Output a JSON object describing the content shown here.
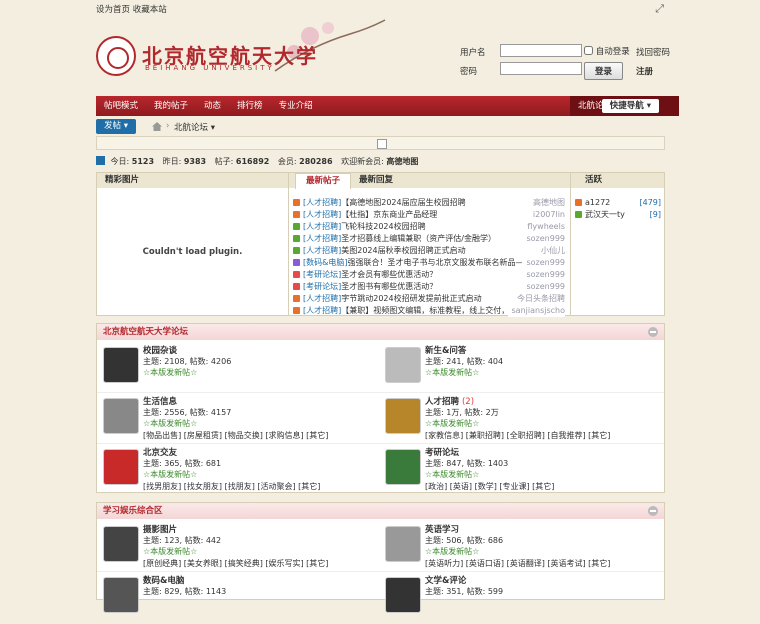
{
  "topbar": {
    "set_home": "设为首页",
    "bookmark": "收藏本站"
  },
  "logo": {
    "cn": "北京航空航天大学",
    "en": "BEIHANG UNIVERSITY"
  },
  "login": {
    "username_label": "用户名",
    "password_label": "密码",
    "auto_login": "自动登录",
    "forgot": "找回密码",
    "login_btn": "登录",
    "register": "注册"
  },
  "nav": {
    "items": [
      "北航论坛",
      "帖吧模式",
      "我的帖子",
      "动态",
      "排行榜",
      "专业介绍"
    ],
    "active_index": 0,
    "quick": "快捷导航"
  },
  "crumb": {
    "post": "发帖",
    "label": "北航论坛"
  },
  "stats": {
    "today_label": "今日:",
    "today": "5123",
    "yesterday_label": "昨日:",
    "yesterday": "9383",
    "posts_label": "帖子:",
    "posts": "616892",
    "members_label": "会员:",
    "members": "280286",
    "welcome_label": "欢迎新会员:",
    "newest": "高德地图"
  },
  "panel": {
    "pic_tab": "精彩图片",
    "plugin_msg": "Couldn't load plugin.",
    "tab_new": "最新帖子",
    "tab_reply": "最新回复",
    "active_tab": "活跃",
    "threads": [
      {
        "cat": "[人才招聘]",
        "title": "【高德地图2024届应届生校园招聘",
        "author": "高德地图",
        "color": "#e8702a"
      },
      {
        "cat": "[人才招聘]",
        "title": "【杜指】京东商业产品经理",
        "author": "i2007lin",
        "color": "#e8702a"
      },
      {
        "cat": "[人才招聘]",
        "title": "飞轮科技2024校园招聘",
        "author": "flywheels",
        "color": "#5aa832"
      },
      {
        "cat": "[人才招聘]",
        "title": "圣才招募线上编辑兼职（资产评估/金融学）",
        "author": "sozen999",
        "color": "#5aa832"
      },
      {
        "cat": "[人才招聘]",
        "title": "美图2024届秋季校园招聘正式启动",
        "author": "小仙儿",
        "color": "#5aa832"
      },
      {
        "cat": "[数码&电脑]",
        "title": "强强联合！圣才电子书与北京文服发布联名新品——圣才...",
        "author": "sozen999",
        "color": "#8a5ad8"
      },
      {
        "cat": "[考研论坛]",
        "title": "圣才会员有哪些优惠活动？",
        "author": "sozen999",
        "color": "#e84a4a"
      },
      {
        "cat": "[考研论坛]",
        "title": "圣才图书有哪些优惠活动？",
        "author": "sozen999",
        "color": "#e84a4a"
      },
      {
        "cat": "[人才招聘]",
        "title": "字节跳动2024校招研发提前批正式启动",
        "author": "今日头条招聘",
        "color": "#e8702a"
      },
      {
        "cat": "[人才招聘]",
        "title": "【兼职】视频图文编辑，标准教程，线上交付，熟练加薪",
        "author": "sanjiansjscho",
        "color": "#e8702a"
      }
    ],
    "active_users": [
      {
        "name": "a1272",
        "count": "[479]",
        "color": "#e8702a"
      },
      {
        "name": "武汉天一ty",
        "count": "[9]",
        "color": "#5aa832"
      }
    ]
  },
  "sections": [
    {
      "title": "北京航空航天大学论坛",
      "forums": [
        {
          "name": "校园杂谈",
          "stats": "主题: 2108, 帖数: 4206",
          "promo": "☆本版发新帖☆",
          "subs": "",
          "icon": "#333",
          "new": ""
        },
        {
          "name": "新生&问答",
          "stats": "主题: 241, 帖数: 404",
          "promo": "☆本版发新帖☆",
          "subs": "",
          "icon": "#bbb",
          "new": ""
        },
        {
          "name": "生活信息",
          "stats": "主题: 2556, 帖数: 4157",
          "promo": "☆本版发新帖☆",
          "subs": "[物品出售] [房屋租赁] [物品交换] [求购信息] [其它]",
          "icon": "#888",
          "new": ""
        },
        {
          "name": "人才招聘",
          "stats": "主题: 1万, 帖数: 2万",
          "promo": "☆本版发新帖☆",
          "subs": "[家教信息] [兼职招聘] [全职招聘] [自我推荐] [其它]",
          "icon": "#b8862a",
          "new": "(2)"
        },
        {
          "name": "北京交友",
          "stats": "主题: 365, 帖数: 681",
          "promo": "☆本版发新帖☆",
          "subs": "[找男朋友] [找女朋友] [找朋友] [活动聚会] [其它]",
          "icon": "#c82a2a",
          "new": ""
        },
        {
          "name": "考研论坛",
          "stats": "主题: 847, 帖数: 1403",
          "promo": "☆本版发新帖☆",
          "subs": "[政治] [英语] [数学] [专业课] [其它]",
          "icon": "#3a7a3a",
          "new": ""
        }
      ]
    },
    {
      "title": "学习娱乐综合区",
      "forums": [
        {
          "name": "摄影图片",
          "stats": "主题: 123, 帖数: 442",
          "promo": "☆本版发新帖☆",
          "subs": "[原创经典] [美女养眼] [搞笑经典] [娱乐写实] [其它]",
          "icon": "#444",
          "new": ""
        },
        {
          "name": "英语学习",
          "stats": "主题: 506, 帖数: 686",
          "promo": "☆本版发新帖☆",
          "subs": "[英语听力] [英语口语] [英语翻译] [英语考试] [其它]",
          "icon": "#999",
          "new": ""
        },
        {
          "name": "数码&电脑",
          "stats": "主题: 829, 帖数: 1143",
          "promo": "",
          "subs": "",
          "icon": "#555",
          "new": ""
        },
        {
          "name": "文学&评论",
          "stats": "主题: 351, 帖数: 599",
          "promo": "",
          "subs": "",
          "icon": "#333",
          "new": ""
        }
      ]
    }
  ]
}
